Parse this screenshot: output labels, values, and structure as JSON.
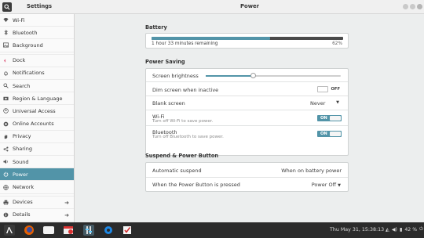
{
  "window": {
    "app_title": "Settings",
    "panel_title": "Power"
  },
  "sidebar": {
    "items": [
      {
        "label": "Wi-Fi",
        "icon": "wifi-icon"
      },
      {
        "label": "Bluetooth",
        "icon": "bluetooth-icon"
      },
      {
        "label": "Background",
        "icon": "background-icon"
      },
      {
        "label": "Dock",
        "icon": "dock-icon"
      },
      {
        "label": "Notifications",
        "icon": "bell-icon"
      },
      {
        "label": "Search",
        "icon": "search-icon"
      },
      {
        "label": "Region & Language",
        "icon": "camera-icon"
      },
      {
        "label": "Universal Access",
        "icon": "accessibility-icon"
      },
      {
        "label": "Online Accounts",
        "icon": "cloud-icon"
      },
      {
        "label": "Privacy",
        "icon": "hand-icon"
      },
      {
        "label": "Sharing",
        "icon": "share-icon"
      },
      {
        "label": "Sound",
        "icon": "speaker-icon"
      },
      {
        "label": "Power",
        "icon": "power-icon",
        "active": true
      },
      {
        "label": "Network",
        "icon": "network-icon"
      },
      {
        "label": "Devices",
        "icon": "printer-icon"
      },
      {
        "label": "Details",
        "icon": "info-icon"
      }
    ]
  },
  "battery": {
    "section_title": "Battery",
    "remaining": "1 hour 33 minutes remaining",
    "percent_label": "62%",
    "level": 0.62
  },
  "power_saving": {
    "section_title": "Power Saving",
    "brightness": {
      "label": "Screen brightness",
      "level": 0.35
    },
    "dim": {
      "label": "Dim screen when inactive",
      "state": "OFF"
    },
    "blank": {
      "label": "Blank screen",
      "value": "Never"
    },
    "wifi": {
      "label": "Wi-Fi",
      "sub": "Turn off Wi-Fi to save power.",
      "state": "ON"
    },
    "bluetooth": {
      "label": "Bluetooth",
      "sub": "Turn off Bluetooth to save power.",
      "state": "ON"
    }
  },
  "suspend": {
    "section_title": "Suspend & Power Button",
    "auto": {
      "label": "Automatic suspend",
      "value": "When on battery power"
    },
    "button": {
      "label": "When the Power Button is pressed",
      "value": "Power Off"
    }
  },
  "taskbar": {
    "clock": "Thu May 31, 15:38:13",
    "battery": "42 %"
  },
  "colors": {
    "accent": "#5294a8",
    "taskbar": "#2b2b2b"
  }
}
